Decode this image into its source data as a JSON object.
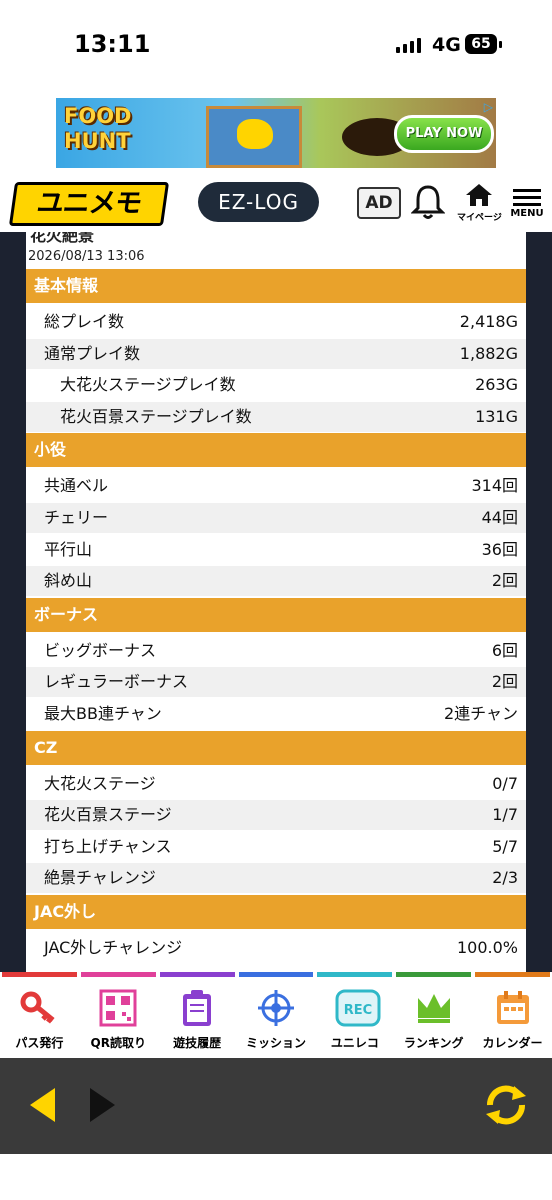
{
  "status": {
    "time": "13:11",
    "network": "4G",
    "battery": "65"
  },
  "ad": {
    "brand_line1": "FOOD",
    "brand_line2": "HUNT",
    "cta": "PLAY NOW"
  },
  "header": {
    "logo": "ユニメモ",
    "ezlog": "EZ-LOG",
    "ad_label": "AD",
    "mypage_label": "マイページ",
    "menu_label": "MENU"
  },
  "content": {
    "title_cut": "花火絶景",
    "date": "2026/08/13 13:06",
    "sections": [
      {
        "title": "基本情報",
        "rows": [
          {
            "label": "総プレイ数",
            "value": "2,418G",
            "indent": false
          },
          {
            "label": "通常プレイ数",
            "value": "1,882G",
            "indent": false
          },
          {
            "label": "大花火ステージプレイ数",
            "value": "263G",
            "indent": true
          },
          {
            "label": "花火百景ステージプレイ数",
            "value": "131G",
            "indent": true
          }
        ]
      },
      {
        "title": "小役",
        "rows": [
          {
            "label": "共通ベル",
            "value": "314回",
            "indent": false
          },
          {
            "label": "チェリー",
            "value": "44回",
            "indent": false
          },
          {
            "label": "平行山",
            "value": "36回",
            "indent": false
          },
          {
            "label": "斜め山",
            "value": "2回",
            "indent": false
          }
        ]
      },
      {
        "title": "ボーナス",
        "rows": [
          {
            "label": "ビッグボーナス",
            "value": "6回",
            "indent": false
          },
          {
            "label": "レギュラーボーナス",
            "value": "2回",
            "indent": false
          },
          {
            "label": "最大BB連チャン",
            "value": "2連チャン",
            "indent": false
          }
        ]
      },
      {
        "title": "CZ",
        "rows": [
          {
            "label": "大花火ステージ",
            "value": "0/7",
            "indent": false
          },
          {
            "label": "花火百景ステージ",
            "value": "1/7",
            "indent": false
          },
          {
            "label": "打ち上げチャンス",
            "value": "5/7",
            "indent": false
          },
          {
            "label": "絶景チャレンジ",
            "value": "2/3",
            "indent": false
          }
        ]
      },
      {
        "title": "JAC外し",
        "rows": [
          {
            "label": "JAC外しチャレンジ",
            "value": "100.0%",
            "indent": false
          }
        ]
      }
    ]
  },
  "tabs": [
    {
      "label": "パス発行",
      "icon": "key-icon",
      "color": "#e23a3a"
    },
    {
      "label": "QR読取り",
      "icon": "qr-icon",
      "color": "#e0409a"
    },
    {
      "label": "遊技履歴",
      "icon": "clipboard-icon",
      "color": "#8a3fcf"
    },
    {
      "label": "ミッション",
      "icon": "target-icon",
      "color": "#3a6fe0"
    },
    {
      "label": "ユニレコ",
      "icon": "unireco-icon",
      "color": "#2fb8c8"
    },
    {
      "label": "ランキング",
      "icon": "crown-icon",
      "color": "#3a9a3a"
    },
    {
      "label": "カレンダー",
      "icon": "calendar-icon",
      "color": "#e07a1a"
    }
  ]
}
